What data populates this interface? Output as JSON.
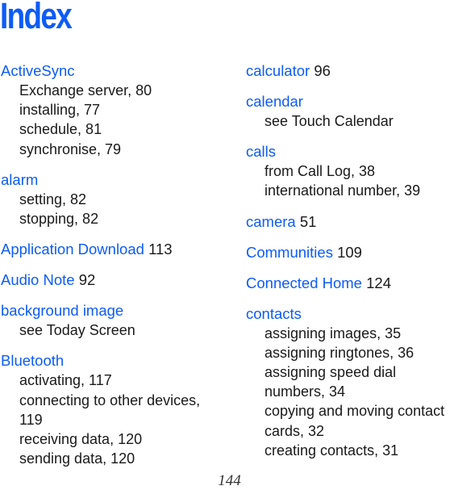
{
  "title": "Index",
  "page_number": "144",
  "colors": {
    "accent": "#0d5cf5",
    "text": "#1a1a1a"
  },
  "columns": [
    {
      "entries": [
        {
          "term": "ActiveSync",
          "page": "",
          "subs": [
            "Exchange server, 80",
            "installing, 77",
            "schedule, 81",
            "synchronise, 79"
          ]
        },
        {
          "term": "alarm",
          "page": "",
          "subs": [
            "setting, 82",
            "stopping, 82"
          ]
        },
        {
          "term": "Application Download",
          "page": "113",
          "subs": []
        },
        {
          "term": "Audio Note",
          "page": "92",
          "subs": []
        },
        {
          "term": "background image",
          "page": "",
          "subs": [
            "see Today Screen"
          ]
        },
        {
          "term": "Bluetooth",
          "page": "",
          "subs": [
            "activating, 117",
            "connecting to other devices,",
            "119",
            "receiving data, 120",
            "sending data, 120"
          ]
        }
      ]
    },
    {
      "entries": [
        {
          "term": "calculator",
          "page": "96",
          "subs": []
        },
        {
          "term": "calendar",
          "page": "",
          "subs": [
            "see Touch Calendar"
          ]
        },
        {
          "term": "calls",
          "page": "",
          "subs": [
            "from Call Log, 38",
            "international number, 39"
          ]
        },
        {
          "term": "camera",
          "page": "51",
          "subs": []
        },
        {
          "term": "Communities",
          "page": "109",
          "subs": []
        },
        {
          "term": "Connected Home",
          "page": "124",
          "subs": []
        },
        {
          "term": "contacts",
          "page": "",
          "subs": [
            "assigning images, 35",
            "assigning ringtones, 36",
            "assigning speed dial",
            "numbers, 34",
            "copying and moving contact",
            "cards, 32",
            "creating contacts, 31"
          ]
        }
      ]
    }
  ]
}
